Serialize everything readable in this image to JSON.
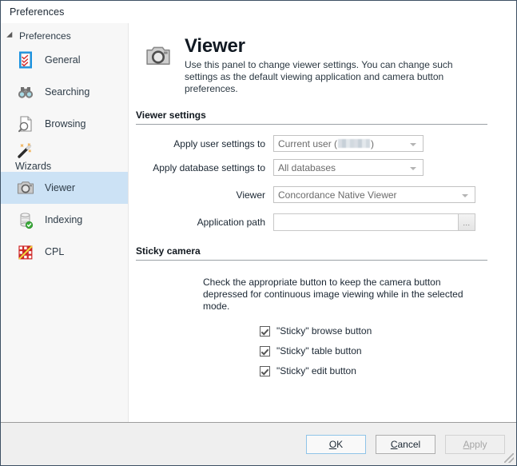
{
  "window": {
    "title": "Preferences"
  },
  "sidebar": {
    "root_label": "Preferences",
    "items": [
      {
        "label": "General",
        "icon": "checklist-icon",
        "selected": false
      },
      {
        "label": "Searching",
        "icon": "binoculars-icon",
        "selected": false
      },
      {
        "label": "Browsing",
        "icon": "document-search-icon",
        "selected": false
      },
      {
        "label": "Wizards",
        "icon": "magic-wand-icon",
        "selected": false
      },
      {
        "label": "Viewer",
        "icon": "camera-icon",
        "selected": true
      },
      {
        "label": "Indexing",
        "icon": "database-check-icon",
        "selected": false
      },
      {
        "label": "CPL",
        "icon": "cpl-grid-icon",
        "selected": false
      }
    ]
  },
  "page": {
    "icon": "camera-icon",
    "title": "Viewer",
    "description": "Use this panel to change viewer settings. You can change such settings as the default viewing application and camera button preferences."
  },
  "viewer_settings": {
    "section_title": "Viewer settings",
    "fields": [
      {
        "label": "Apply user settings to",
        "control": "combobox",
        "value_prefix": "Current user (",
        "value_redacted": true,
        "value_suffix": ")",
        "disabled": true
      },
      {
        "label": "Apply database settings to",
        "control": "combobox",
        "value": "All databases",
        "disabled": true
      },
      {
        "label": "Viewer",
        "control": "combobox",
        "value": "Concordance Native Viewer",
        "disabled": true
      },
      {
        "label": "Application path",
        "control": "textbox-with-browse",
        "value": "",
        "browse_label": "..."
      }
    ]
  },
  "sticky_camera": {
    "section_title": "Sticky camera",
    "description": "Check the appropriate button to keep the camera button depressed for continuous image viewing while in the selected mode.",
    "checkboxes": [
      {
        "label": "\"Sticky\" browse button",
        "checked": true
      },
      {
        "label": "\"Sticky\" table button",
        "checked": true
      },
      {
        "label": "\"Sticky\" edit button",
        "checked": true
      }
    ]
  },
  "footer": {
    "buttons": [
      {
        "name": "ok",
        "prefix": "",
        "accel": "O",
        "suffix": "K",
        "state": "default"
      },
      {
        "name": "cancel",
        "prefix": "",
        "accel": "C",
        "suffix": "ancel",
        "state": "normal"
      },
      {
        "name": "apply",
        "prefix": "",
        "accel": "A",
        "suffix": "pply",
        "state": "disabled"
      }
    ]
  },
  "colors": {
    "selection": "#cce2f5",
    "sidebar_bg": "#f7f7f7",
    "footer_bg": "#efefef",
    "window_border": "#3d5063",
    "rule": "#9aa0a6"
  }
}
